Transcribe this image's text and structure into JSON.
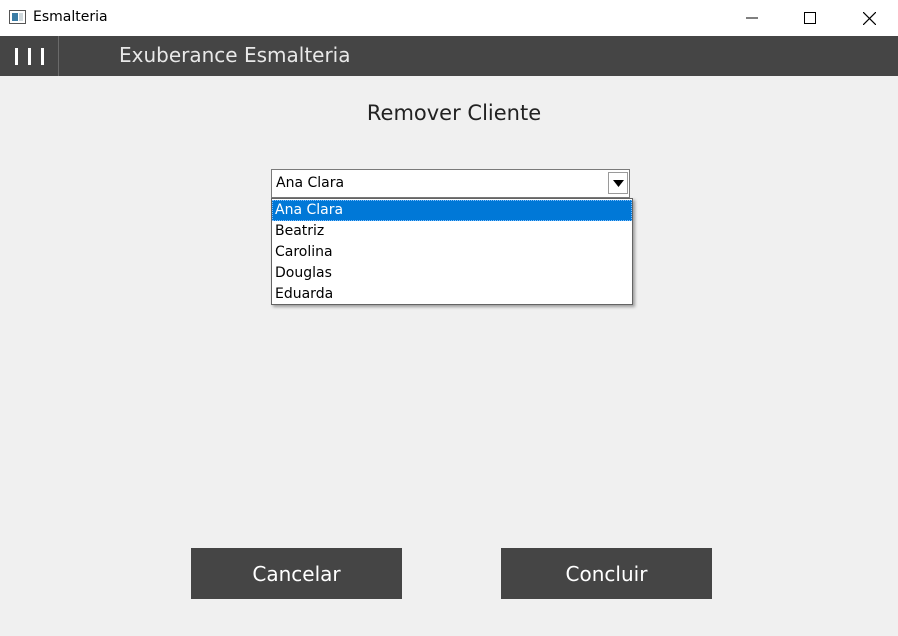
{
  "window": {
    "title": "Esmalteria",
    "controls": [
      "minimize-icon",
      "maximize-icon",
      "close-icon"
    ]
  },
  "header": {
    "menu_icon": "hamburger-icon",
    "title": "Exuberance Esmalteria"
  },
  "main": {
    "title": "Remover Cliente",
    "client_select": {
      "value": "Ana Clara",
      "options": [
        "Ana Clara",
        "Beatriz",
        "Carolina",
        "Douglas",
        "Eduarda"
      ],
      "selected_index": 0
    }
  },
  "footer": {
    "cancel_label": "Cancelar",
    "confirm_label": "Concluir"
  },
  "colors": {
    "header_bg": "#454545",
    "content_bg": "#f0f0f0",
    "selection": "#0078d7"
  }
}
